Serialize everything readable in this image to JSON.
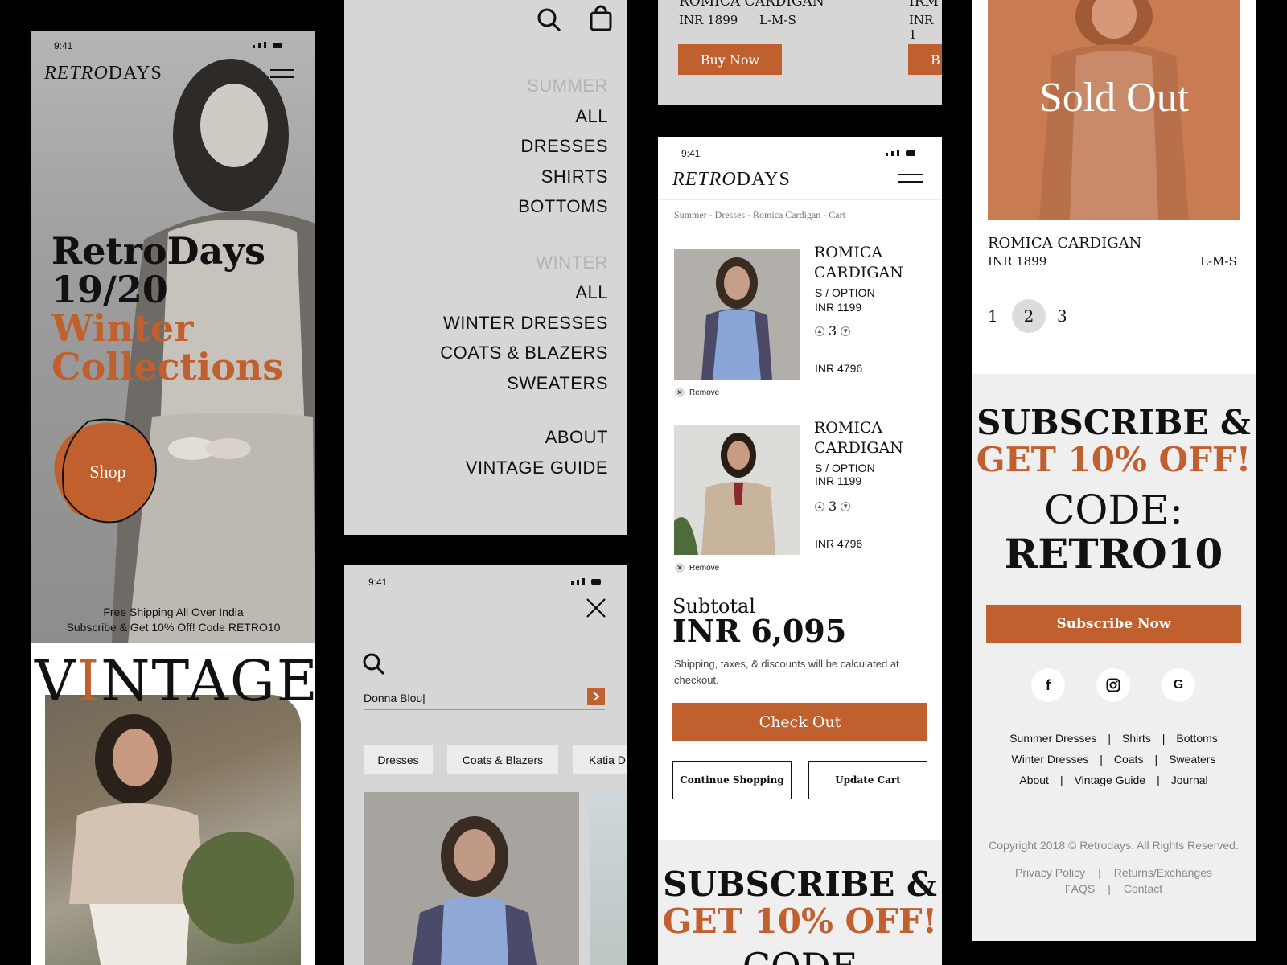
{
  "status_time": "9:41",
  "colors": {
    "accent": "#c0602f",
    "panel_grey": "#d6d6d6",
    "light_grey": "#efefef"
  },
  "home": {
    "logo_italic": "RETRO",
    "logo_rest": "DAYS",
    "hero_line1": "RetroDays",
    "hero_line2": "19/20",
    "hero_line3": "Winter",
    "hero_line4": "Collections",
    "shop_label": "Shop",
    "promo_line1": "Free Shipping All Over India",
    "promo_line2": "Subscribe & Get 10% Off! Code RETRO10",
    "vintage_pre": "V",
    "vintage_mid": "I",
    "vintage_post": "NTAGE"
  },
  "menu": {
    "summer_heading": "SUMMER",
    "summer_items": [
      "ALL",
      "DRESSES",
      "SHIRTS",
      "BOTTOMS"
    ],
    "winter_heading": "WINTER",
    "winter_items": [
      "ALL",
      "WINTER DRESSES",
      "COATS & BLAZERS",
      "SWEATERS"
    ],
    "extra_items": [
      "ABOUT",
      "VINTAGE GUIDE"
    ]
  },
  "search": {
    "query": "Donna Blou|",
    "chips": [
      "Dresses",
      "Coats & Blazers",
      "Katia D"
    ]
  },
  "listing_top": {
    "item1_name": "ROMICA CARDIGAN",
    "item1_price": "INR 1899",
    "item1_sizes": "L-M-S",
    "item2_name": "IRM",
    "item2_price": "INR 1",
    "buy_label": "Buy Now",
    "buy_label_cut": "B"
  },
  "cart": {
    "logo_italic": "RETRO",
    "logo_rest": "DAYS",
    "breadcrumb": "Summer - Dresses - Romica Cardigan - Cart",
    "items": [
      {
        "name1": "ROMICA",
        "name2": "CARDIGAN",
        "option": "S / OPTION",
        "price": "INR 1199",
        "qty": "3",
        "total": "INR 4796",
        "remove": "Remove"
      },
      {
        "name1": "ROMICA",
        "name2": "CARDIGAN",
        "option": "S / OPTION",
        "price": "INR 1199",
        "qty": "3",
        "total": "INR 4796",
        "remove": "Remove"
      }
    ],
    "subtotal_label": "Subtotal",
    "subtotal_value": "INR 6,095",
    "note": "Shipping, taxes, & discounts will be calculated at checkout.",
    "checkout_label": "Check Out",
    "continue_label": "Continue Shopping",
    "update_label": "Update Cart",
    "sub_line1": "SUBSCRIBE &",
    "sub_line2": "GET 10% OFF!",
    "sub_line3": "CODE"
  },
  "product": {
    "sold_out": "Sold Out",
    "name": "ROMICA CARDIGAN",
    "price": "INR 1899",
    "sizes": "L-M-S",
    "pages": [
      "1",
      "2",
      "3"
    ],
    "sub_line1": "SUBSCRIBE &",
    "sub_line2": "GET 10% OFF!",
    "code_line1": "CODE:",
    "code_line2": "RETRO10",
    "subscribe_label": "Subscribe Now",
    "social": [
      "f",
      "instagram-icon",
      "G"
    ],
    "footer_row1": [
      "Summer Dresses",
      "Shirts",
      "Bottoms"
    ],
    "footer_row2": [
      "Winter Dresses",
      "Coats",
      "Sweaters"
    ],
    "footer_row3": [
      "About",
      "Vintage Guide",
      "Journal"
    ],
    "copyright": "Copyright 2018 © Retrodays. All Rights Reserved.",
    "legal_row1": [
      "Privacy Policy",
      "Returns/Exchanges"
    ],
    "legal_row2": [
      "FAQS",
      "Contact"
    ]
  }
}
